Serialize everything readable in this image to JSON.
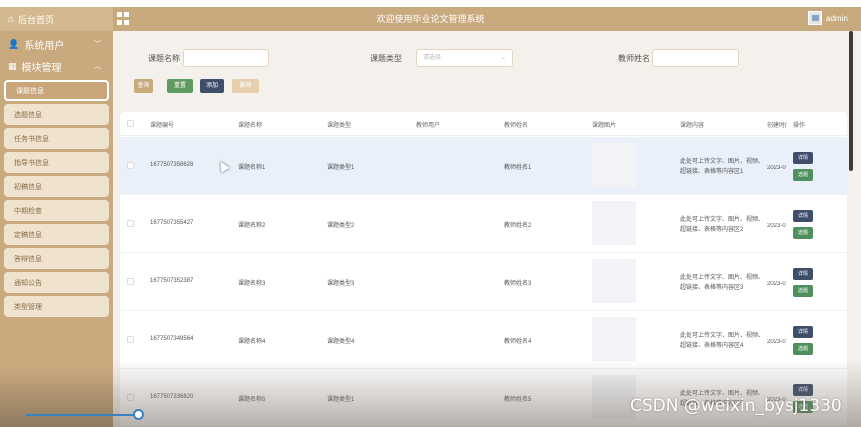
{
  "topbar": {
    "home_label": "后台首页",
    "title": "欢迎使用毕业论文管理系统",
    "user": "admin"
  },
  "sidebar": {
    "groups": [
      {
        "label": "系统用户"
      },
      {
        "label": "模块管理"
      }
    ],
    "items": [
      {
        "label": "课题信息",
        "active": true
      },
      {
        "label": "选题信息"
      },
      {
        "label": "任务书信息"
      },
      {
        "label": "指导书信息"
      },
      {
        "label": "初稿信息"
      },
      {
        "label": "中期检查"
      },
      {
        "label": "定稿信息"
      },
      {
        "label": "答辩信息"
      },
      {
        "label": "通知公告"
      },
      {
        "label": "类型管理"
      }
    ]
  },
  "search": {
    "topic_name_label": "课题名称",
    "topic_type_label": "课题类型",
    "topic_type_placeholder": "请选择",
    "teacher_name_label": "教师姓名"
  },
  "toolbar": {
    "query": "查询",
    "reset": "重置",
    "add": "添加",
    "delete": "删除"
  },
  "table": {
    "headers": [
      "课题编号",
      "课题名称",
      "课题类型",
      "教师用户",
      "教师姓名",
      "课题图片",
      "课题内容",
      "创建时间",
      "操作"
    ],
    "rows": [
      {
        "id": "1677507358628",
        "name": "课题名称1",
        "type": "课题类型1",
        "teacher_user": "",
        "teacher_name": "教师姓名1",
        "content": "此处可上传文字、图片、视频、超链接、表格等内容区1",
        "created": "2023-0"
      },
      {
        "id": "1677507355427",
        "name": "课题名称2",
        "type": "课题类型2",
        "teacher_user": "",
        "teacher_name": "教师姓名2",
        "content": "此处可上传文字、图片、视频、超链接、表格等内容区2",
        "created": "2023-0"
      },
      {
        "id": "1677507352387",
        "name": "课题名称3",
        "type": "课题类型3",
        "teacher_user": "",
        "teacher_name": "教师姓名3",
        "content": "此处可上传文字、图片、视频、超链接、表格等内容区3",
        "created": "2023-0"
      },
      {
        "id": "1677507349564",
        "name": "课题名称4",
        "type": "课题类型4",
        "teacher_user": "",
        "teacher_name": "教师姓名4",
        "content": "此处可上传文字、图片、视频、超链接、表格等内容区4",
        "created": "2023-0"
      },
      {
        "id": "1677507336820",
        "name": "课题名称5",
        "type": "课题类型1",
        "teacher_user": "",
        "teacher_name": "教师姓名5",
        "content": "此处可上传文字、图片、视频、超链接、表格等内容区5",
        "created": "2023-0"
      }
    ],
    "detail_label": "详情",
    "pick_label": "选题"
  },
  "watermark": "CSDN @weixin_bysj1330",
  "colors": {
    "brand": "#c9a97e",
    "sidebar_item_bg": "#efe2cf",
    "detail_button": "#3d4d6a",
    "pick_button": "#4f8f5b",
    "query_button": "#c9a97e",
    "reset_button": "#5e9b61",
    "add_button": "#3d4d6a",
    "delete_button": "#e7cfae"
  }
}
